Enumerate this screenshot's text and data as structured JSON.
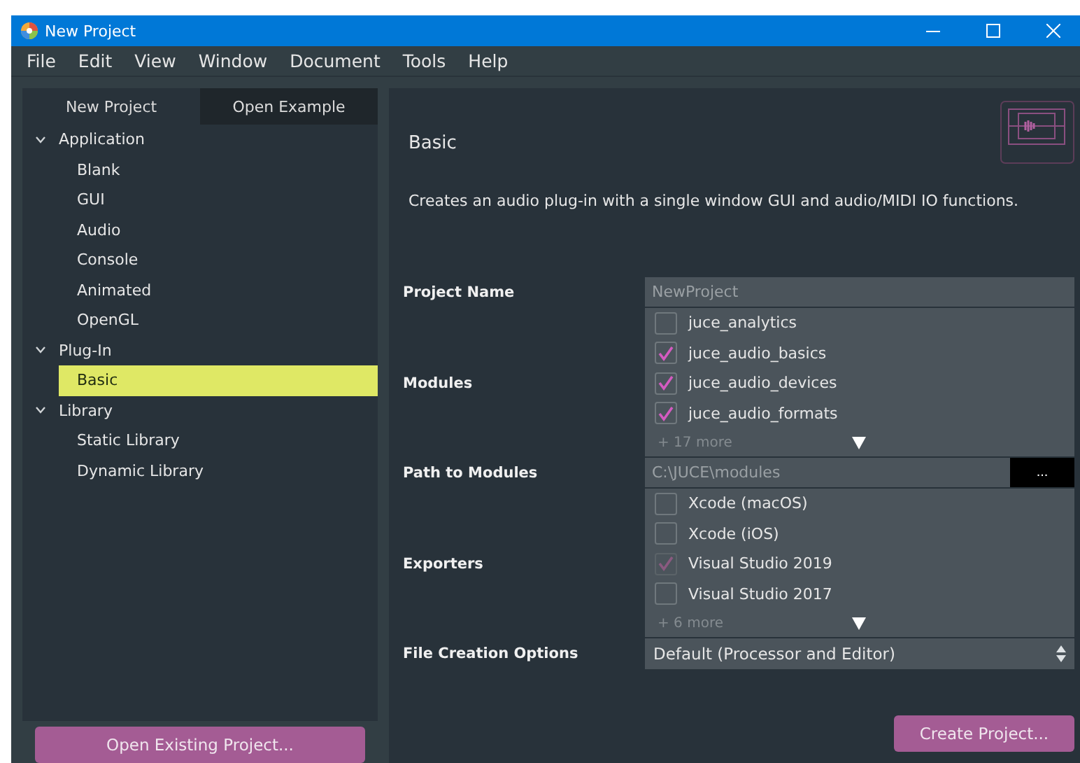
{
  "window": {
    "title": "New Project"
  },
  "menu": [
    "File",
    "Edit",
    "View",
    "Window",
    "Document",
    "Tools",
    "Help"
  ],
  "tabs": [
    {
      "label": "New Project",
      "selected": true
    },
    {
      "label": "Open Example",
      "selected": false
    }
  ],
  "tree": [
    {
      "label": "Application",
      "expanded": true,
      "selected": false,
      "children": [
        {
          "label": "Blank",
          "selected": false
        },
        {
          "label": "GUI",
          "selected": false
        },
        {
          "label": "Audio",
          "selected": false
        },
        {
          "label": "Console",
          "selected": false
        },
        {
          "label": "Animated",
          "selected": false
        },
        {
          "label": "OpenGL",
          "selected": false
        }
      ]
    },
    {
      "label": "Plug-In",
      "expanded": true,
      "selected": false,
      "children": [
        {
          "label": "Basic",
          "selected": true
        }
      ]
    },
    {
      "label": "Library",
      "expanded": true,
      "selected": false,
      "children": [
        {
          "label": "Static Library",
          "selected": false
        },
        {
          "label": "Dynamic Library",
          "selected": false
        }
      ]
    }
  ],
  "open_button": "Open Existing Project...",
  "detail": {
    "title": "Basic",
    "description": "Creates an audio plug-in with a single window GUI and audio/MIDI IO functions.",
    "fields": [
      {
        "kind": "text",
        "label": "Project Name",
        "placeholder": "NewProject"
      },
      {
        "kind": "checklist",
        "label": "Modules",
        "items": [
          {
            "label": "juce_analytics",
            "checked": false,
            "disabled": false
          },
          {
            "label": "juce_audio_basics",
            "checked": true,
            "disabled": false
          },
          {
            "label": "juce_audio_devices",
            "checked": true,
            "disabled": false
          },
          {
            "label": "juce_audio_formats",
            "checked": true,
            "disabled": false
          }
        ],
        "more": "+ 17 more"
      },
      {
        "kind": "path",
        "label": "Path to Modules",
        "placeholder": "C:\\JUCE\\modules",
        "button": "..."
      },
      {
        "kind": "checklist",
        "label": "Exporters",
        "items": [
          {
            "label": "Xcode (macOS)",
            "checked": false,
            "disabled": false
          },
          {
            "label": "Xcode (iOS)",
            "checked": false,
            "disabled": false
          },
          {
            "label": "Visual Studio 2019",
            "checked": true,
            "disabled": true
          },
          {
            "label": "Visual Studio 2017",
            "checked": false,
            "disabled": false
          }
        ],
        "more": "+ 6 more"
      },
      {
        "kind": "select",
        "label": "File Creation Options",
        "value": "Default (Processor and Editor)"
      }
    ]
  },
  "create_button": "Create Project..."
}
